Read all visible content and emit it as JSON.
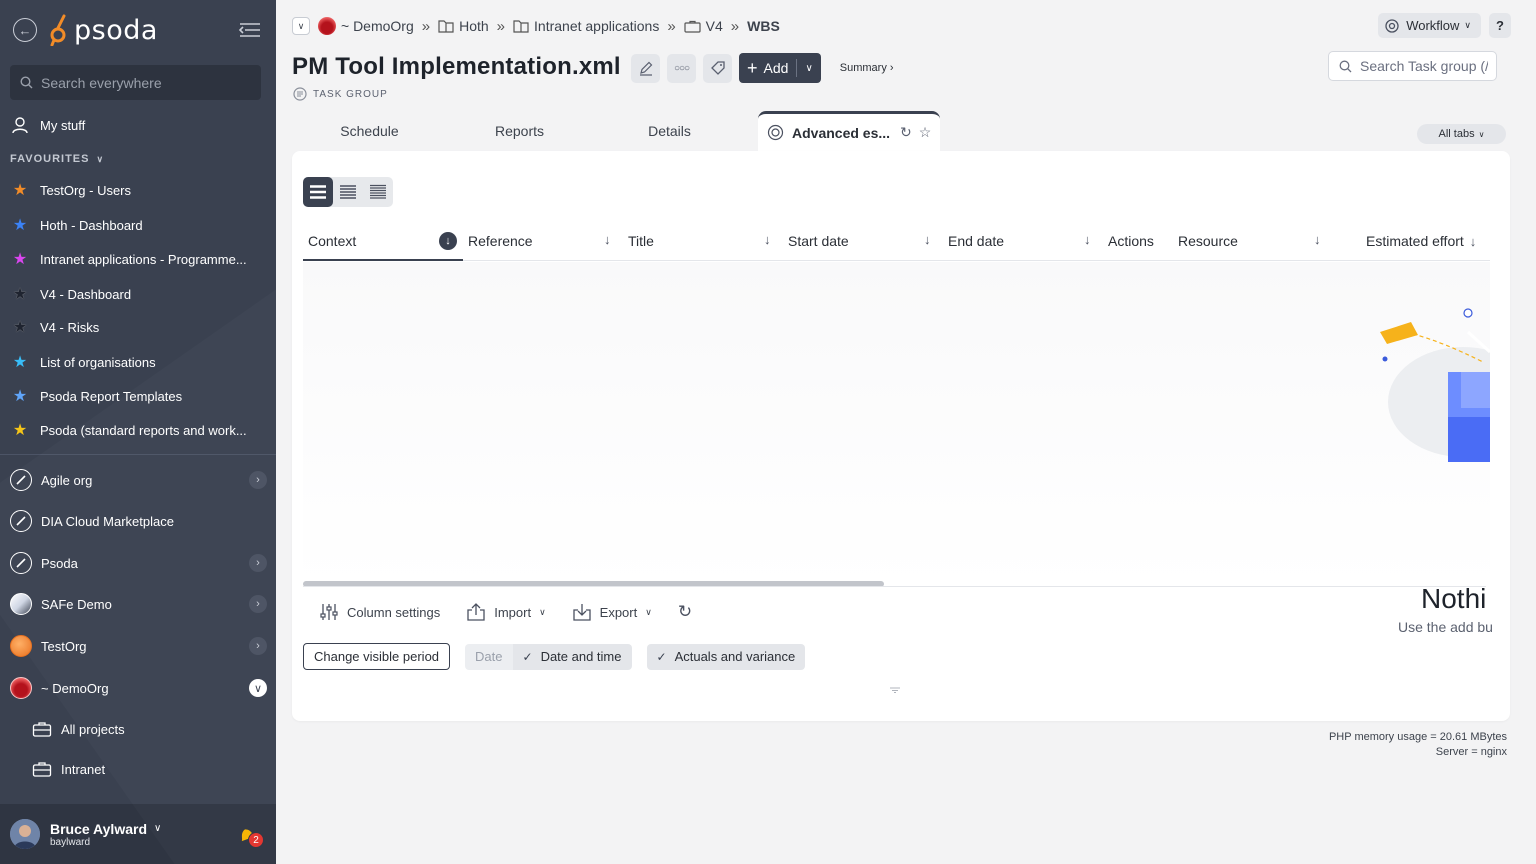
{
  "sidebar": {
    "logo_text": "psoda",
    "search_placeholder": "Search everywhere",
    "my_stuff": "My stuff",
    "favourites_header": "FAVOURITES",
    "favourites": [
      {
        "label": "TestOrg - Users",
        "color": "#f28c28"
      },
      {
        "label": "Hoth - Dashboard",
        "color": "#3b82f6"
      },
      {
        "label": "Intranet applications - Programme...",
        "color": "#d946ef"
      },
      {
        "label": "V4 - Dashboard",
        "color": "#1f2430"
      },
      {
        "label": "V4 - Risks",
        "color": "#1f2430"
      },
      {
        "label": "List of organisations",
        "color": "#38bdf8"
      },
      {
        "label": "Psoda Report Templates",
        "color": "#60a5fa"
      },
      {
        "label": "Psoda (standard reports and work...",
        "color": "#f5c518"
      }
    ],
    "orgs": [
      {
        "label": "Agile org"
      },
      {
        "label": "DIA Cloud Marketplace"
      },
      {
        "label": "Psoda"
      },
      {
        "label": "SAFe Demo"
      },
      {
        "label": "TestOrg"
      },
      {
        "label": "~ DemoOrg"
      }
    ],
    "sub_items": [
      {
        "label": "All projects"
      },
      {
        "label": "Intranet"
      }
    ],
    "user": {
      "name": "Bruce Aylward",
      "handle": "baylward",
      "notifications": "2"
    }
  },
  "breadcrumbs": [
    {
      "label": "~ DemoOrg"
    },
    {
      "label": "Hoth"
    },
    {
      "label": "Intranet applications"
    },
    {
      "label": "V4"
    },
    {
      "label": "WBS"
    }
  ],
  "header": {
    "workflow": "Workflow",
    "help": "?",
    "title": "PM Tool Implementation.xml",
    "subtitle": "TASK GROUP",
    "add_label": "Add",
    "summary_link": "Summary ›",
    "task_search_placeholder": "Search Task group (/"
  },
  "tabs": [
    {
      "label": "Schedule"
    },
    {
      "label": "Reports"
    },
    {
      "label": "Details"
    },
    {
      "label": "Advanced es..."
    }
  ],
  "all_tabs": "All tabs",
  "grid": {
    "columns": [
      {
        "label": "Context"
      },
      {
        "label": "Reference"
      },
      {
        "label": "Title"
      },
      {
        "label": "Start date"
      },
      {
        "label": "End date"
      },
      {
        "label": "Actions"
      },
      {
        "label": "Resource"
      },
      {
        "label": "Estimated effort"
      }
    ],
    "empty_title": "Nothi",
    "empty_subtitle": "Use the add bu"
  },
  "tools": {
    "column_settings": "Column settings",
    "import": "Import",
    "export": "Export"
  },
  "period": {
    "change": "Change visible period",
    "date": "Date",
    "date_time": "Date and time",
    "actuals": "Actuals and variance"
  },
  "footer": {
    "memory": "PHP memory usage = 20.61 MBytes",
    "server": "Server = nginx"
  }
}
